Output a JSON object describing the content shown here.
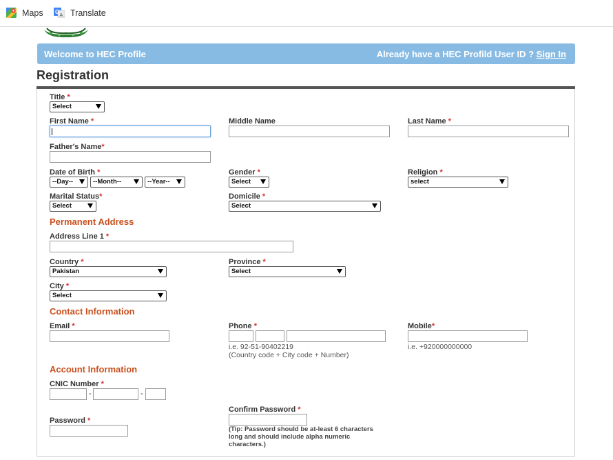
{
  "bookmarks": [
    {
      "label": "Maps",
      "icon": "maps-icon"
    },
    {
      "label": "Translate",
      "icon": "translate-icon"
    }
  ],
  "banner": {
    "welcome": "Welcome to HEC Profile",
    "already": "Already have a HEC Profild User ID ?",
    "signin": "Sign In"
  },
  "page_title": "Registration",
  "req": "*",
  "form": {
    "title_label": "Title",
    "title_value": "Select",
    "first_name_label": "First Name",
    "middle_name_label": "Middle Name",
    "last_name_label": "Last Name",
    "father_name_label": "Father's Name",
    "dob_label": "Date of Birth",
    "dob_day": "--Day--",
    "dob_month": "--Month--",
    "dob_year": "--Year--",
    "gender_label": "Gender",
    "gender_value": "Select",
    "religion_label": "Religion",
    "religion_value": "select",
    "marital_label": "Marital Status",
    "marital_value": "Select",
    "domicile_label": "Domicile",
    "domicile_value": "Select"
  },
  "permanent": {
    "heading": "Permanent Address",
    "address_label": "Address Line 1",
    "country_label": "Country",
    "country_value": "Pakistan",
    "province_label": "Province",
    "province_value": "Select",
    "city_label": "City",
    "city_value": "Select"
  },
  "contact": {
    "heading": "Contact Information",
    "email_label": "Email",
    "phone_label": "Phone",
    "phone_hint1": "i.e. 92-51-90402219",
    "phone_hint2": "(Country code + City code + Number)",
    "mobile_label": "Mobile",
    "mobile_hint": "i.e. +920000000000"
  },
  "account": {
    "heading": "Account Information",
    "cnic_label": "CNIC Number",
    "dash": "-",
    "password_label": "Password",
    "confirm_label": "Confirm Password",
    "tip": "(Tip: Password should be at-least 6 characters long and should include alpha numeric characters.)"
  },
  "colors": {
    "banner_bg": "#88bbe3",
    "section_heading": "#c8501e",
    "required": "#d2322d"
  }
}
